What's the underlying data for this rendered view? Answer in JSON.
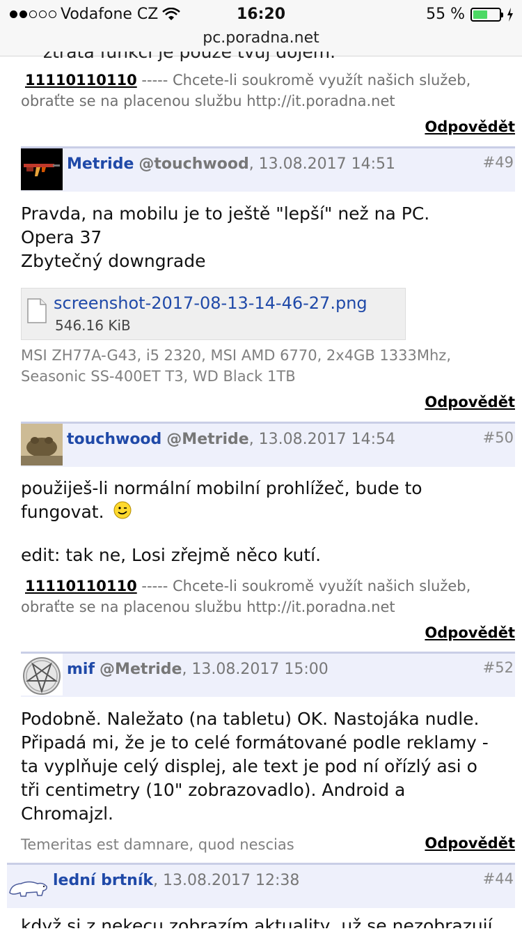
{
  "status": {
    "carrier": "Vodafone CZ",
    "time": "16:20",
    "battery": "55 %",
    "battery_level": 0.55,
    "url": "pc.poradna.net"
  },
  "top": {
    "cut_text": "ztráta funkcí je pouze tvůj dojem.",
    "sig_num": "11110110110",
    "sig_text": "----- Chcete-li soukromě využít našich služeb,",
    "sig_text2": "obraťte se na placenou službu http://it.poradna.net",
    "reply": "Odpovědět"
  },
  "posts": [
    {
      "user": "Metride",
      "at": "@touchwood",
      "date": ", 13.08.2017 14:51",
      "num": "#49",
      "lines": [
        "Pravda, na mobilu je to ještě \"lepší\" než na PC.",
        "Opera 37",
        "Zbytečný downgrade"
      ],
      "attachment": {
        "name": "screenshot-2017-08-13-14-46-27.png",
        "size": "546.16 KiB"
      },
      "signature": [
        "MSI ZH77A-G43, i5 2320, MSI AMD 6770, 2x4GB 1333Mhz,",
        "Seasonic SS-400ET T3, WD Black 1TB"
      ],
      "reply": "Odpovědět"
    },
    {
      "user": "touchwood",
      "at": "@Metride",
      "date": ", 13.08.2017 14:54",
      "num": "#50",
      "lines": [
        "použiješ-li normální mobilní prohlížeč, bude to",
        "fungovat.",
        "edit: tak ne, Losi zřejmě něco kutí."
      ],
      "sig_num": "11110110110",
      "sig_text": "----- Chcete-li soukromě využít našich služeb,",
      "sig_text2": "obraťte se na placenou službu http://it.poradna.net",
      "reply": "Odpovědět"
    },
    {
      "user": "mif",
      "at": "@Metride",
      "date": ", 13.08.2017 15:00",
      "num": "#52",
      "lines": [
        "Podobně. Naležato (na tabletu) OK. Nastojáka nudle.",
        "Připadá mi, že je to celé formátované podle reklamy -",
        "ta vyplňuje celý displej, ale text je pod ní ořízlý asi o",
        "tři centimetry (10\" zobrazovadlo). Android a",
        "Chromajzl."
      ],
      "signature": "Temeritas est damnare, quod nescias",
      "reply": "Odpovědět"
    },
    {
      "user": "lední brtník",
      "date": ", 13.08.2017 12:38",
      "num": "#44",
      "cut": "když si z nekecu zobrazím aktuality, už se nezobrazují"
    }
  ]
}
